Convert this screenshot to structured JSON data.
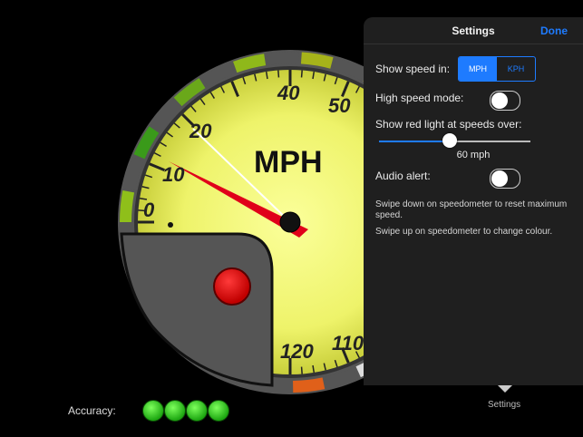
{
  "gauge": {
    "unit": "MPH",
    "tick_labels": [
      "0",
      "10",
      "20",
      "40",
      "50",
      "120",
      "110"
    ]
  },
  "accuracy": {
    "label": "Accuracy:",
    "level": 4,
    "max": 4
  },
  "settings": {
    "title": "Settings",
    "done_label": "Done",
    "speed_units_label": "Show speed in:",
    "speed_units_options": [
      "MPH",
      "KPH"
    ],
    "speed_units_selected": "MPH",
    "high_speed_mode_label": "High speed mode:",
    "high_speed_mode": false,
    "red_light_label": "Show red light at speeds over:",
    "red_light_value_text": "60 mph",
    "red_light_fraction": 0.47,
    "audio_alert_label": "Audio alert:",
    "audio_alert": false,
    "help_reset": "Swipe down on speedometer to reset maximum speed.",
    "help_colour": "Swipe up on speedometer to change colour.",
    "tab_label": "Settings"
  },
  "colors": {
    "accent": "#1e7bff",
    "dial_face": "#eef36a",
    "needle": "#e0001a",
    "max_needle": "#ffffff",
    "indicator_ok": "#2fd21c"
  }
}
